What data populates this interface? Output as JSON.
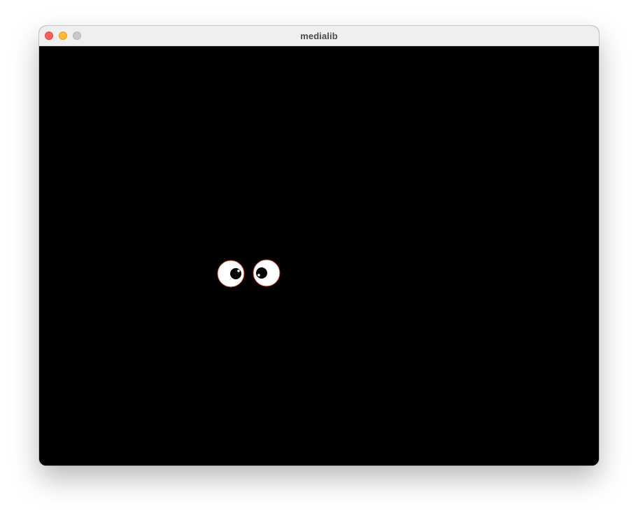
{
  "window": {
    "title": "medialib",
    "buttons": {
      "close": "close-icon",
      "minimize": "minimize-icon",
      "zoom": "zoom-icon"
    }
  },
  "canvas": {
    "background": "#000000",
    "eye_white": "#ffffff",
    "eye_outline": "#b8321b",
    "pupil": "#000000"
  }
}
